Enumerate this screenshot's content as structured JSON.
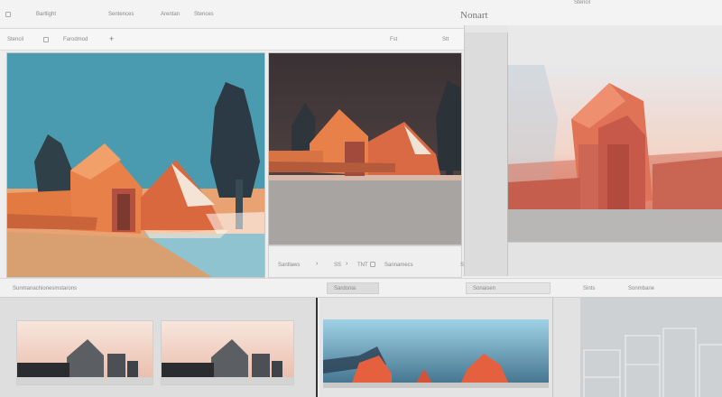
{
  "window": {
    "title": "Nonart",
    "top_right_label": "Stencil",
    "tabs": [
      "Bartlight",
      "Sentences",
      "Arentan",
      "Stences"
    ]
  },
  "toolbar": {
    "left_label": "Stencil",
    "mid_label": "Farodmod",
    "right_label_1": "Fst",
    "right_label_2": "Stt"
  },
  "panel_b": {
    "controls": [
      "Santlaws",
      "SS",
      "TNT",
      "Sannamecs"
    ],
    "side_label": "Sannr"
  },
  "status": {
    "left_label": "Sunmanachionesmstarons",
    "mid_badge": "Sardonia",
    "right_badge": "Sonaisen",
    "far_right_1": "Sints",
    "far_right_2": "Sonmbane"
  },
  "colors": {
    "sky_teal": "#4a9bb0",
    "building_orange": "#e8804a",
    "dark_trees": "#2b3a44",
    "warm_brown": "#4a3a36",
    "salmon_red": "#d4685a",
    "accent_dark": "#1e1e1e"
  }
}
